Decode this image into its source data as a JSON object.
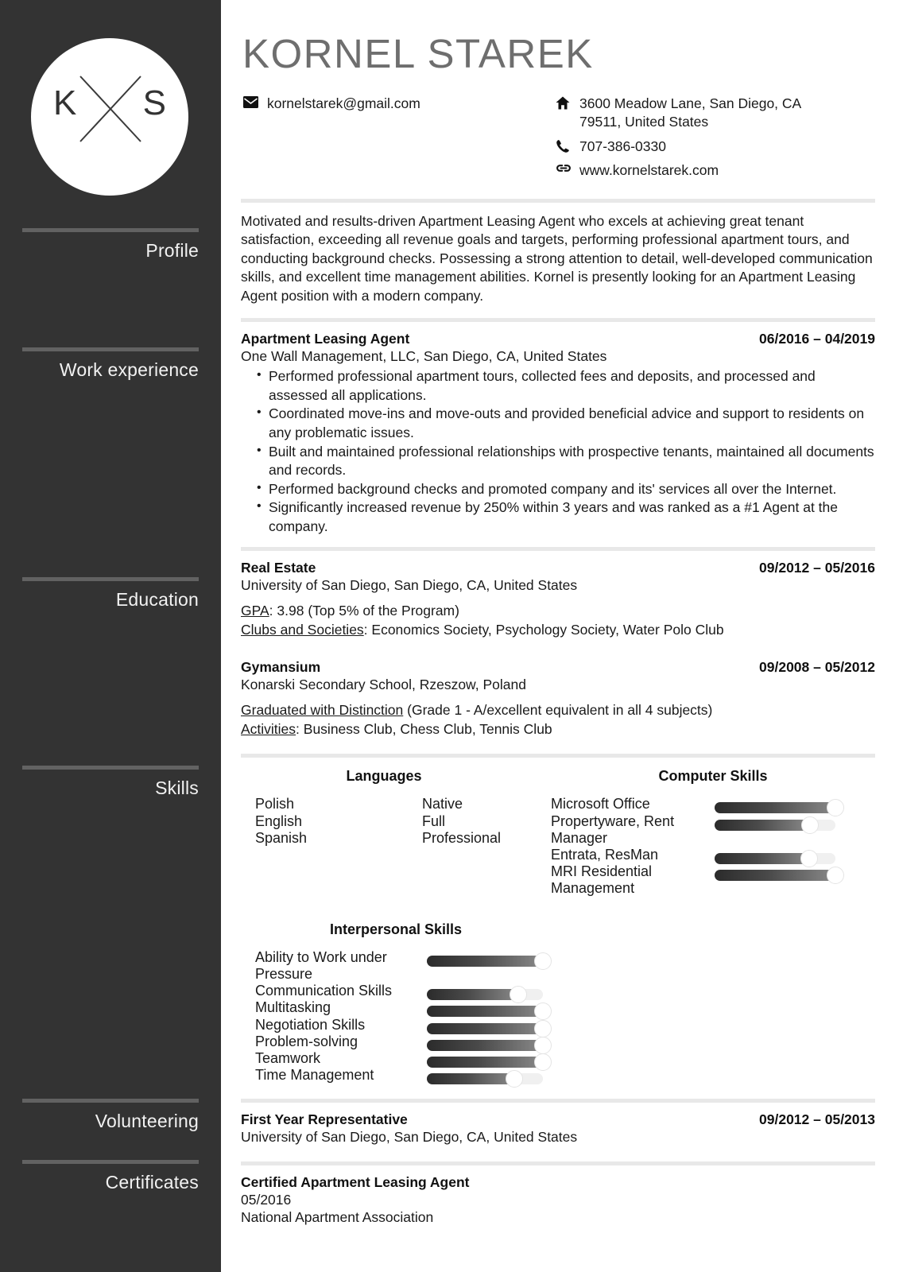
{
  "sidebar": {
    "logo": {
      "initial_left": "K",
      "initial_right": "S"
    },
    "sections": [
      {
        "label": "Profile"
      },
      {
        "label": "Work experience"
      },
      {
        "label": "Education"
      },
      {
        "label": "Skills"
      },
      {
        "label": "Volunteering"
      },
      {
        "label": "Certificates"
      }
    ]
  },
  "header": {
    "name": "KORNEL STAREK",
    "contacts_left": [
      {
        "icon": "envelope-icon",
        "text": "kornelstarek@gmail.com"
      }
    ],
    "contacts_right": [
      {
        "icon": "home-icon",
        "line1": "3600 Meadow Lane, San Diego, CA",
        "line2": "79511, United States"
      },
      {
        "icon": "phone-icon",
        "line1": "707-386-0330",
        "line2": ""
      },
      {
        "icon": "link-icon",
        "line1": "www.kornelstarek.com",
        "line2": ""
      }
    ]
  },
  "profile": {
    "text": "Motivated and results-driven Apartment Leasing Agent who excels at achieving great tenant satisfaction, exceeding all revenue goals and targets, performing professional apartment tours, and conducting background checks. Possessing a strong attention to detail, well-developed communication skills, and excellent time management abilities. Kornel is presently looking for an Apartment Leasing Agent position with a modern company."
  },
  "work_experience": {
    "entries": [
      {
        "title": "Apartment Leasing Agent",
        "date": "06/2016 – 04/2019",
        "subtitle": "One Wall Management, LLC, San Diego, CA, United States",
        "bullets": [
          "Performed professional apartment tours, collected fees and deposits, and processed and assessed all applications.",
          "Coordinated move-ins and move-outs and provided beneficial advice and support to residents on any problematic issues.",
          "Built and maintained professional relationships with prospective tenants, maintained all documents and records.",
          "Performed background checks and promoted company and its' services all over the Internet.",
          "Significantly increased revenue by 250% within 3 years and was ranked as a #1 Agent at the company."
        ]
      }
    ]
  },
  "education": {
    "entries": [
      {
        "title": "Real Estate",
        "date": "09/2012 – 05/2016",
        "subtitle": "University of San Diego, San Diego, CA, United States",
        "details": [
          {
            "label": "GPA",
            "value": ": 3.98 (Top 5% of the Program)"
          },
          {
            "label": "Clubs and Societies",
            "value": ": Economics Society, Psychology Society, Water Polo Club"
          }
        ]
      },
      {
        "title": "Gymansium",
        "date": "09/2008 – 05/2012",
        "subtitle": "Konarski Secondary School, Rzeszow, Poland",
        "details": [
          {
            "label": "Graduated with Distinction",
            "value": " (Grade 1 - A/excellent equivalent in all 4 subjects)"
          },
          {
            "label": "Activities",
            "value": ": Business Club, Chess Club, Tennis Club"
          }
        ]
      }
    ]
  },
  "skills": {
    "languages": {
      "heading": "Languages",
      "items": [
        {
          "name": "Polish",
          "level": "Native"
        },
        {
          "name": "English",
          "level": "Full"
        },
        {
          "name": "Spanish",
          "level": "Professional"
        }
      ]
    },
    "computer": {
      "heading": "Computer Skills",
      "items": [
        {
          "name": "Microsoft Office",
          "percent": 100
        },
        {
          "name": "Propertyware, Rent Manager",
          "percent": 79
        },
        {
          "name": "Entrata, ResMan",
          "percent": 78
        },
        {
          "name": "MRI Residential Management",
          "percent": 100
        }
      ]
    },
    "interpersonal": {
      "heading": "Interpersonal Skills",
      "items": [
        {
          "name": "Ability to Work under Pressure",
          "percent": 100
        },
        {
          "name": "Communication Skills",
          "percent": 79
        },
        {
          "name": "Multitasking",
          "percent": 100
        },
        {
          "name": "Negotiation Skills",
          "percent": 100
        },
        {
          "name": "Problem-solving",
          "percent": 100
        },
        {
          "name": "Teamwork",
          "percent": 100
        },
        {
          "name": "Time Management",
          "percent": 75
        }
      ]
    }
  },
  "volunteering": {
    "entries": [
      {
        "title": "First Year Representative",
        "date": "09/2012 – 05/2013",
        "subtitle": "University of San Diego, San Diego, CA, United States"
      }
    ]
  },
  "certificates": {
    "entries": [
      {
        "title": "Certified Apartment Leasing Agent",
        "date_line": "05/2016",
        "issuer": "National Apartment Association"
      }
    ]
  },
  "colors": {
    "sidebar_bg": "#333333",
    "name_color": "#6e6e6e",
    "rule_light": "#e8e8e8",
    "rule_sidebar": "#6b6b6b"
  }
}
